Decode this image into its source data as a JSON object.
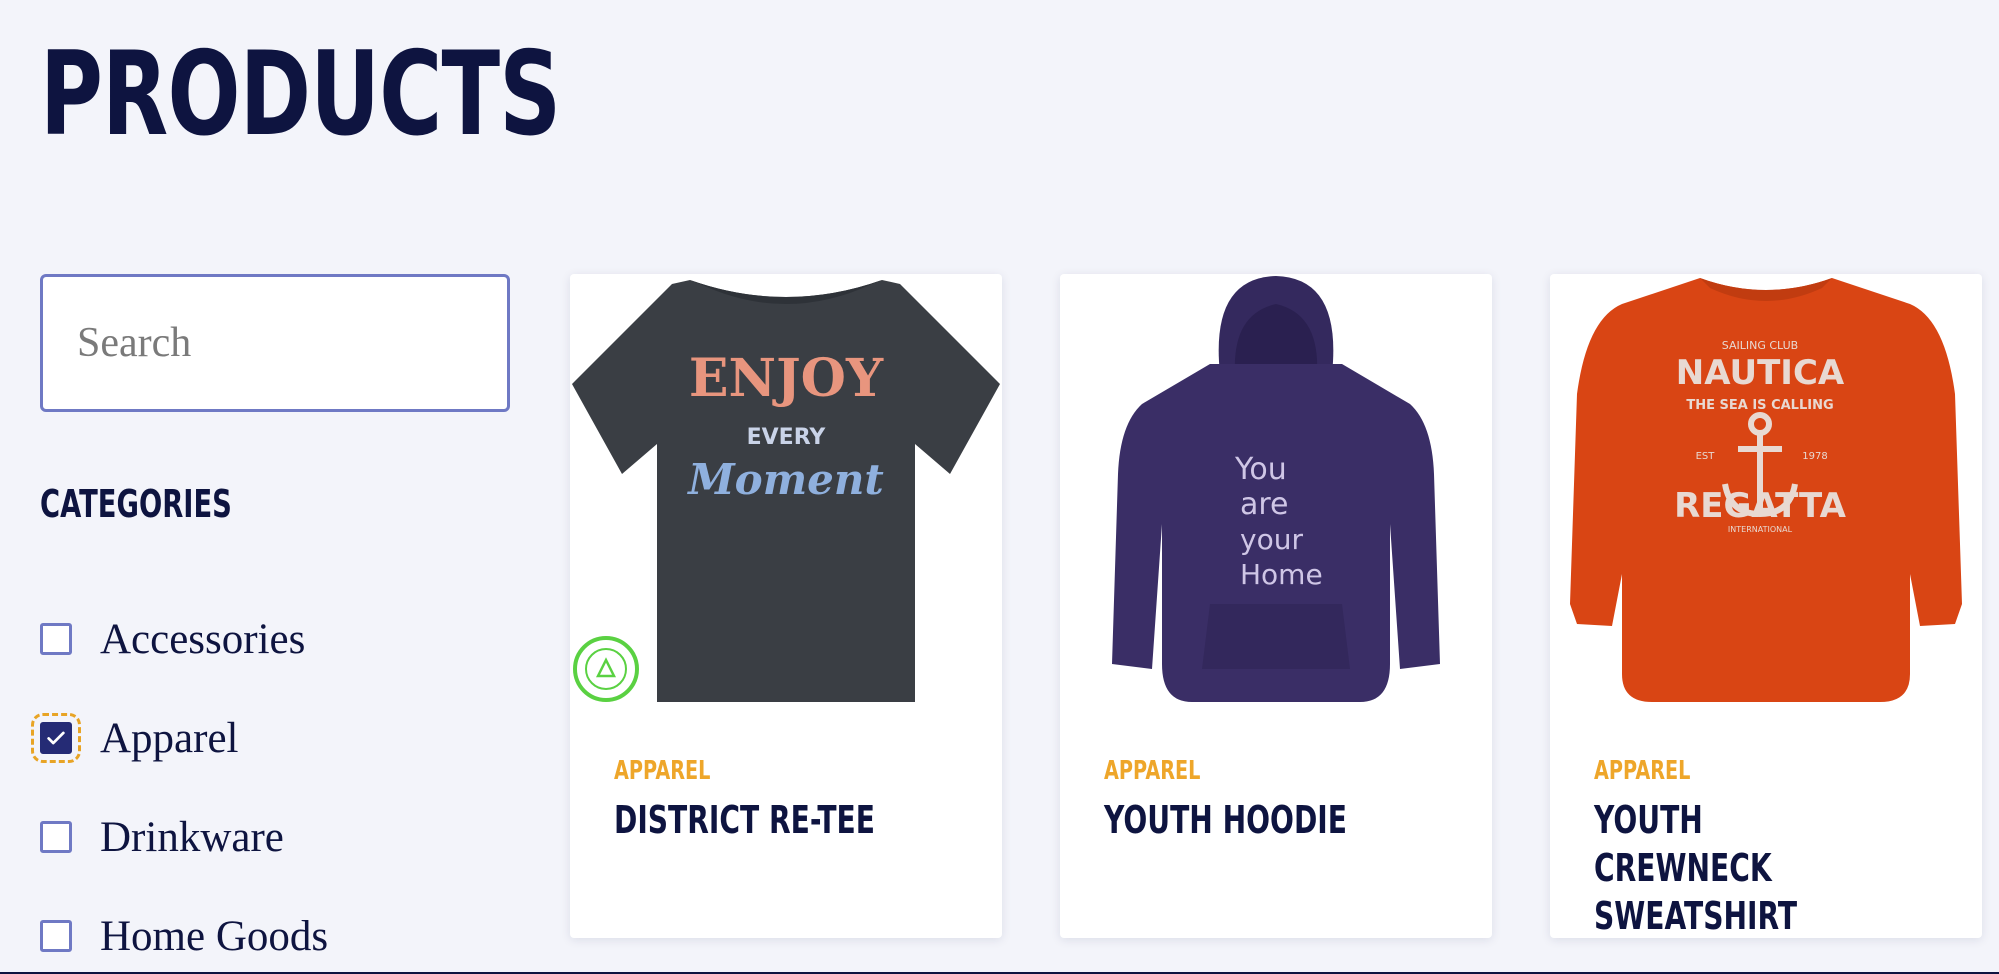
{
  "page": {
    "title": "PRODUCTS"
  },
  "search": {
    "placeholder": "Search",
    "value": ""
  },
  "categories": {
    "heading": "CATEGORIES",
    "items": [
      {
        "label": "Accessories",
        "checked": false
      },
      {
        "label": "Apparel",
        "checked": true
      },
      {
        "label": "Drinkware",
        "checked": false
      },
      {
        "label": "Home Goods",
        "checked": false
      }
    ]
  },
  "products": [
    {
      "category": "APPAREL",
      "name": "DISTRICT RE-TEE",
      "image": {
        "garment": "t-shirt",
        "color": "#3a3e44",
        "print_lines": [
          "ENJOY",
          "EVERY",
          "Moment"
        ],
        "badge": "MADE OF RECYCLED MATERIALS"
      }
    },
    {
      "category": "APPAREL",
      "name": "YOUTH HOODIE",
      "image": {
        "garment": "hoodie",
        "color": "#3a2e66",
        "print_lines": [
          "You",
          "are",
          "your",
          "Home"
        ]
      }
    },
    {
      "category": "APPAREL",
      "name": "YOUTH CREWNECK SWEATSHIRT",
      "image": {
        "garment": "sweatshirt",
        "color": "#d94514",
        "print_lines": [
          "SAILING CLUB",
          "NAUTICA",
          "THE SEA IS CALLING",
          "EST",
          "1978",
          "REGATTA",
          "INTERNATIONAL"
        ]
      }
    }
  ],
  "colors": {
    "accent": "#eea62a",
    "navy": "#0e1440",
    "border": "#6f79c4",
    "background": "#f3f4fa"
  }
}
